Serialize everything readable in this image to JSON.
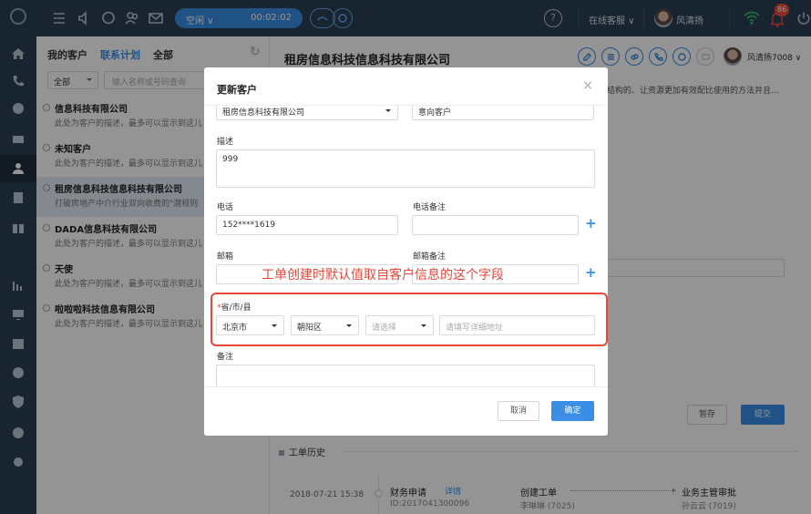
{
  "topbar": {
    "status": "空闲 ∨",
    "timer": "00:02:02",
    "service": "在线客服 ∨",
    "user": "风清扬",
    "badge": "86"
  },
  "list_panel": {
    "tabs": [
      "我的客户",
      "联系计划",
      "全部"
    ],
    "filter": "全部",
    "search_placeholder": "输入名称或号码查询",
    "customers": [
      {
        "name": "信息科技有限公司",
        "desc": "此处为客户的描述，最多可以显示到这儿"
      },
      {
        "name": "未知客户",
        "desc": "此处为客户的描述，最多可以显示到这儿"
      },
      {
        "name": "租房信息科技信息科技有限公司",
        "desc": "打破房地产中介行业双向收费的\"潜规则"
      },
      {
        "name": "DADA信息科技有限公司",
        "desc": "此处为客户的描述，最多可以显示到这儿"
      },
      {
        "name": "天使",
        "desc": "此处为客户的描述，最多可以显示到这儿"
      },
      {
        "name": "啦啦啦科技信息有限公司",
        "desc": "此处为客户的描述，最多可以显示到这儿"
      }
    ]
  },
  "detail": {
    "title": "租房信息科技信息科技有限公司",
    "user": "风清扬7008 ∨",
    "desc_snippet": "结构的、让资源更加有效配比使用的方法并且...",
    "btn_save": "暂存",
    "btn_submit": "提交",
    "history_title": "工单历史",
    "history": {
      "date": "2018-07-21 15:38",
      "name": "财务申请",
      "link": "详情",
      "id": "ID:2017041300096",
      "step1": "创建工单",
      "step1_user": "李琳琳 (7025)",
      "step2": "业务主管审批",
      "step2_user": "孙云云 (7019)"
    }
  },
  "modal": {
    "title": "更新客户",
    "close": "×",
    "company_value": "租房信息科技有限公司",
    "type_value": "意向客户",
    "desc_label": "描述",
    "desc_value": "999",
    "phone_label": "电话",
    "phone_value": "152****1619",
    "phone_note_label": "电话备注",
    "email_label": "邮箱",
    "email_note_label": "邮箱备注",
    "region_label": "省/市/县",
    "required_mark": "*",
    "province": "北京市",
    "city": "朝阳区",
    "district_placeholder": "请选择",
    "address_placeholder": "请填写详细地址",
    "remark_label": "备注",
    "cancel": "取消",
    "ok": "确定"
  },
  "annotation": "工单创建时默认值取自客户信息的这个字段",
  "colors": {
    "accent": "#3a8ee6",
    "annotation": "#e8483b",
    "rail": "#2c3e55"
  }
}
